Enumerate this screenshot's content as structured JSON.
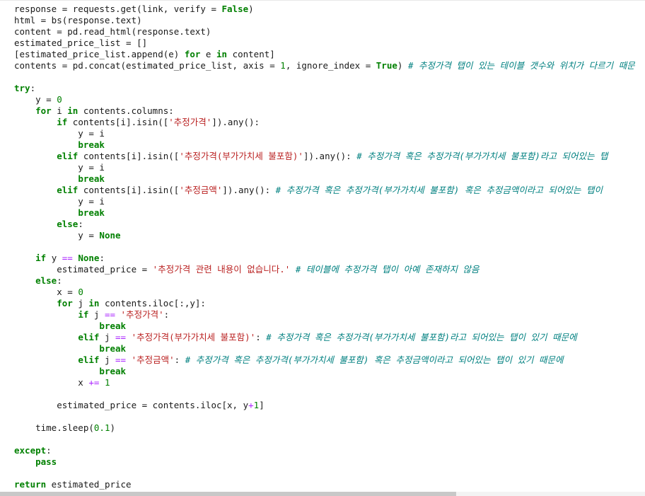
{
  "code_lines": [
    [
      {
        "t": "response = requests.get(link, verify = "
      },
      {
        "t": "False",
        "c": "kw"
      },
      {
        "t": ")"
      }
    ],
    [
      {
        "t": "html = bs(response.text)"
      }
    ],
    [
      {
        "t": "content = pd.read_html(response.text)"
      }
    ],
    [
      {
        "t": "estimated_price_list = []"
      }
    ],
    [
      {
        "t": "[estimated_price_list.append(e) "
      },
      {
        "t": "for",
        "c": "kw"
      },
      {
        "t": " e "
      },
      {
        "t": "in",
        "c": "kw"
      },
      {
        "t": " content]"
      }
    ],
    [
      {
        "t": "contents = pd.concat(estimated_price_list, axis = "
      },
      {
        "t": "1",
        "c": "num"
      },
      {
        "t": ", ignore_index = "
      },
      {
        "t": "True",
        "c": "kw"
      },
      {
        "t": ") "
      },
      {
        "t": "# 추정가격 탭이 있는 테이블 갯수와 위치가 다르기 때문",
        "c": "cmt"
      }
    ],
    [],
    [
      {
        "t": "try",
        "c": "kw"
      },
      {
        "t": ":"
      }
    ],
    [
      {
        "t": "    y = "
      },
      {
        "t": "0",
        "c": "num"
      }
    ],
    [
      {
        "t": "    "
      },
      {
        "t": "for",
        "c": "kw"
      },
      {
        "t": " i "
      },
      {
        "t": "in",
        "c": "kw"
      },
      {
        "t": " contents.columns:"
      }
    ],
    [
      {
        "t": "        "
      },
      {
        "t": "if",
        "c": "kw"
      },
      {
        "t": " contents[i].isin(["
      },
      {
        "t": "'추정가격'",
        "c": "str"
      },
      {
        "t": "]).any():"
      }
    ],
    [
      {
        "t": "            y = i"
      }
    ],
    [
      {
        "t": "            "
      },
      {
        "t": "break",
        "c": "kw"
      }
    ],
    [
      {
        "t": "        "
      },
      {
        "t": "elif",
        "c": "kw"
      },
      {
        "t": " contents[i].isin(["
      },
      {
        "t": "'추정가격(부가가치세 불포함)'",
        "c": "str"
      },
      {
        "t": "]).any(): "
      },
      {
        "t": "# 추정가격 혹은 추정가격(부가가치세 불포함)라고 되어있는 탭",
        "c": "cmt"
      }
    ],
    [
      {
        "t": "            y = i"
      }
    ],
    [
      {
        "t": "            "
      },
      {
        "t": "break",
        "c": "kw"
      }
    ],
    [
      {
        "t": "        "
      },
      {
        "t": "elif",
        "c": "kw"
      },
      {
        "t": " contents[i].isin(["
      },
      {
        "t": "'추정금액'",
        "c": "str"
      },
      {
        "t": "]).any(): "
      },
      {
        "t": "# 추정가격 혹은 추정가격(부가가치세 불포함) 혹은 추정금액이라고 되어있는 탭이",
        "c": "cmt"
      }
    ],
    [
      {
        "t": "            y = i"
      }
    ],
    [
      {
        "t": "            "
      },
      {
        "t": "break",
        "c": "kw"
      }
    ],
    [
      {
        "t": "        "
      },
      {
        "t": "else",
        "c": "kw"
      },
      {
        "t": ":"
      }
    ],
    [
      {
        "t": "            y = "
      },
      {
        "t": "None",
        "c": "kw"
      }
    ],
    [],
    [
      {
        "t": "    "
      },
      {
        "t": "if",
        "c": "kw"
      },
      {
        "t": " y "
      },
      {
        "t": "==",
        "c": "op"
      },
      {
        "t": " "
      },
      {
        "t": "None",
        "c": "kw"
      },
      {
        "t": ":"
      }
    ],
    [
      {
        "t": "        estimated_price = "
      },
      {
        "t": "'추정가격 관련 내용이 없습니다.'",
        "c": "str"
      },
      {
        "t": " "
      },
      {
        "t": "# 테이블에 추정가격 탭이 아예 존재하지 않음",
        "c": "cmt"
      }
    ],
    [
      {
        "t": "    "
      },
      {
        "t": "else",
        "c": "kw"
      },
      {
        "t": ":"
      }
    ],
    [
      {
        "t": "        x = "
      },
      {
        "t": "0",
        "c": "num"
      }
    ],
    [
      {
        "t": "        "
      },
      {
        "t": "for",
        "c": "kw"
      },
      {
        "t": " j "
      },
      {
        "t": "in",
        "c": "kw"
      },
      {
        "t": " contents.iloc[:,y]:"
      }
    ],
    [
      {
        "t": "            "
      },
      {
        "t": "if",
        "c": "kw"
      },
      {
        "t": " j "
      },
      {
        "t": "==",
        "c": "op"
      },
      {
        "t": " "
      },
      {
        "t": "'추정가격'",
        "c": "str"
      },
      {
        "t": ":"
      }
    ],
    [
      {
        "t": "                "
      },
      {
        "t": "break",
        "c": "kw"
      }
    ],
    [
      {
        "t": "            "
      },
      {
        "t": "elif",
        "c": "kw"
      },
      {
        "t": " j "
      },
      {
        "t": "==",
        "c": "op"
      },
      {
        "t": " "
      },
      {
        "t": "'추정가격(부가가치세 불포함)'",
        "c": "str"
      },
      {
        "t": ": "
      },
      {
        "t": "# 추정가격 혹은 추정가격(부가가치세 불포함)라고 되어있는 탭이 있기 때문에",
        "c": "cmt"
      }
    ],
    [
      {
        "t": "                "
      },
      {
        "t": "break",
        "c": "kw"
      }
    ],
    [
      {
        "t": "            "
      },
      {
        "t": "elif",
        "c": "kw"
      },
      {
        "t": " j "
      },
      {
        "t": "==",
        "c": "op"
      },
      {
        "t": " "
      },
      {
        "t": "'추정금액'",
        "c": "str"
      },
      {
        "t": ": "
      },
      {
        "t": "# 추정가격 혹은 추정가격(부가가치세 불포함) 혹은 추정금액이라고 되어있는 탭이 있기 때문에",
        "c": "cmt"
      }
    ],
    [
      {
        "t": "                "
      },
      {
        "t": "break",
        "c": "kw"
      }
    ],
    [
      {
        "t": "            x "
      },
      {
        "t": "+=",
        "c": "op"
      },
      {
        "t": " "
      },
      {
        "t": "1",
        "c": "num"
      }
    ],
    [],
    [
      {
        "t": "        estimated_price = contents.iloc[x, y"
      },
      {
        "t": "+",
        "c": "op"
      },
      {
        "t": "1",
        "c": "num"
      },
      {
        "t": "]"
      }
    ],
    [],
    [
      {
        "t": "    time.sleep("
      },
      {
        "t": "0.1",
        "c": "num"
      },
      {
        "t": ")"
      }
    ],
    [],
    [
      {
        "t": "except",
        "c": "kw"
      },
      {
        "t": ":"
      }
    ],
    [
      {
        "t": "    "
      },
      {
        "t": "pass",
        "c": "kw"
      }
    ],
    [],
    [
      {
        "t": "return",
        "c": "kw"
      },
      {
        "t": " estimated_price"
      }
    ]
  ]
}
